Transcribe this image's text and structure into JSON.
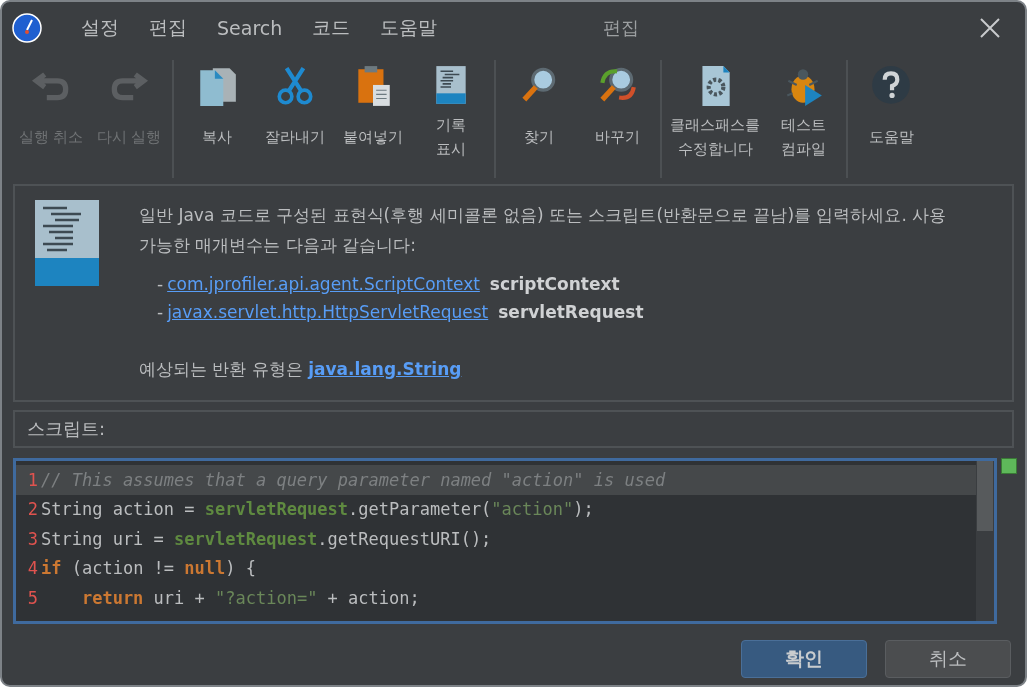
{
  "window": {
    "title": "편집"
  },
  "menu": [
    "설정",
    "편집",
    "Search",
    "코드",
    "도움말"
  ],
  "toolbar": [
    [
      {
        "kind": "undo",
        "label": "실행 취소",
        "disabled": true
      },
      {
        "kind": "redo",
        "label": "다시 실행",
        "disabled": true
      }
    ],
    [
      {
        "kind": "copy",
        "label": "복사",
        "disabled": false
      },
      {
        "kind": "cut",
        "label": "잘라내기",
        "disabled": false
      },
      {
        "kind": "paste",
        "label": "붙여넣기",
        "disabled": false
      },
      {
        "kind": "java",
        "label": "기록\n표시",
        "disabled": false
      }
    ],
    [
      {
        "kind": "find",
        "label": "찾기",
        "disabled": false
      },
      {
        "kind": "replace",
        "label": "바꾸기",
        "disabled": false
      }
    ],
    [
      {
        "kind": "classpath",
        "label": "클래스패스를\n수정합니다",
        "disabled": false
      },
      {
        "kind": "bug",
        "label": "테스트\n컴파일",
        "disabled": false
      }
    ],
    [
      {
        "kind": "help",
        "label": "도움말",
        "disabled": false
      }
    ]
  ],
  "info": {
    "text": "일반 Java 코드로 구성된 표현식(후행 세미콜론 없음) 또는 스크립트(반환문으로 끝남)를 입력하세요. 사용 가능한 매개변수는 다음과 같습니다:",
    "params": [
      {
        "dash": "-",
        "type": "com.jprofiler.api.agent.ScriptContext",
        "name": "scriptContext"
      },
      {
        "dash": "-",
        "type": "javax.servlet.http.HttpServletRequest",
        "name": "servletRequest"
      }
    ],
    "return_text": "예상되는 반환 유형은",
    "return_type": "java.lang.String"
  },
  "script_label": "스크립트:",
  "editor": {
    "lines": [
      {
        "number": "1",
        "current": true,
        "tokens": [
          {
            "kind": "comment",
            "text": "// This assumes that a query parameter named \"action\" is used"
          }
        ]
      },
      {
        "number": "2",
        "current": false,
        "tokens": [
          {
            "kind": "plain",
            "text": "String action = "
          },
          {
            "kind": "field",
            "text": "servletRequest"
          },
          {
            "kind": "plain",
            "text": ".getParameter("
          },
          {
            "kind": "string",
            "text": "\"action\""
          },
          {
            "kind": "plain",
            "text": ");"
          }
        ]
      },
      {
        "number": "3",
        "current": false,
        "tokens": [
          {
            "kind": "plain",
            "text": "String uri = "
          },
          {
            "kind": "field",
            "text": "servletRequest"
          },
          {
            "kind": "plain",
            "text": ".getRequestURI();"
          }
        ]
      },
      {
        "number": "4",
        "current": false,
        "tokens": [
          {
            "kind": "keyword",
            "text": "if"
          },
          {
            "kind": "plain",
            "text": " (action != "
          },
          {
            "kind": "keyword",
            "text": "null"
          },
          {
            "kind": "plain",
            "text": ") {"
          }
        ]
      },
      {
        "number": "5",
        "current": false,
        "tokens": [
          {
            "kind": "keyword",
            "text": "    return"
          },
          {
            "kind": "plain",
            "text": " uri + "
          },
          {
            "kind": "string",
            "text": "\"?action=\""
          },
          {
            "kind": "plain",
            "text": " + action;"
          }
        ]
      }
    ]
  },
  "buttons": [
    {
      "label": "확인",
      "default": true
    },
    {
      "label": "취소",
      "default": false
    }
  ]
}
